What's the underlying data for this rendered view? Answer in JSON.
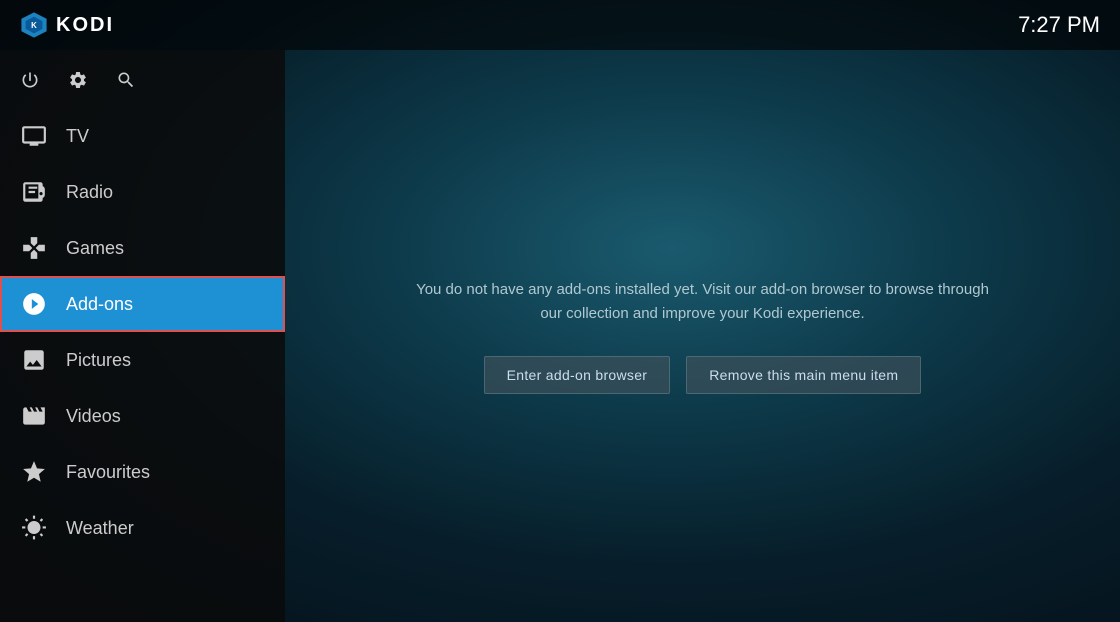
{
  "app": {
    "title": "KODI",
    "clock": "7:27 PM"
  },
  "topbar": {
    "power_label": "Power",
    "settings_label": "Settings",
    "search_label": "Search"
  },
  "sidebar": {
    "items": [
      {
        "id": "tv",
        "label": "TV",
        "icon": "tv-icon"
      },
      {
        "id": "radio",
        "label": "Radio",
        "icon": "radio-icon"
      },
      {
        "id": "games",
        "label": "Games",
        "icon": "games-icon"
      },
      {
        "id": "addons",
        "label": "Add-ons",
        "icon": "addons-icon",
        "active": true
      },
      {
        "id": "pictures",
        "label": "Pictures",
        "icon": "pictures-icon"
      },
      {
        "id": "videos",
        "label": "Videos",
        "icon": "videos-icon"
      },
      {
        "id": "favourites",
        "label": "Favourites",
        "icon": "favourites-icon"
      },
      {
        "id": "weather",
        "label": "Weather",
        "icon": "weather-icon"
      }
    ]
  },
  "main": {
    "message_line1": "You do not have any add-ons installed yet. Visit our add-on browser to browse through",
    "message_line2": "our collection and improve your Kodi experience.",
    "btn_browser": "Enter add-on browser",
    "btn_remove": "Remove this main menu item"
  }
}
